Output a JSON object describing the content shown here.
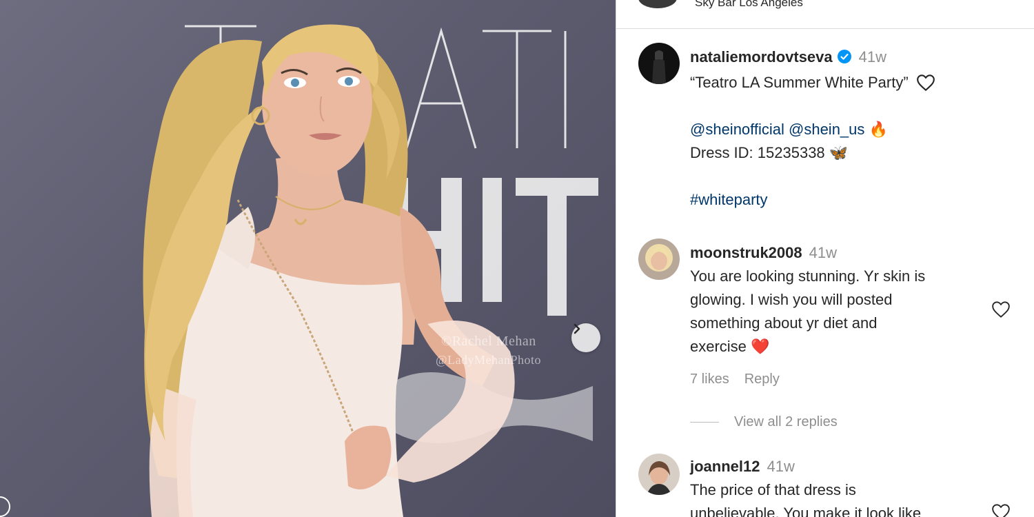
{
  "post": {
    "location": "Sky Bar Los Angeles",
    "author": "nataliemordovtseva",
    "timestamp": "41w",
    "caption_line1": "“Teatro LA Summer White Party”",
    "caption_mentions": "@sheinofficial @shein_us",
    "caption_dress": "Dress ID: 15235338",
    "caption_hashtag": "#whiteparty",
    "emoji_fire": "🔥",
    "emoji_butterfly": "🦋"
  },
  "photo": {
    "watermark_line1": "©Rachel Mehan",
    "watermark_line2": "@LadyMehanPhoto"
  },
  "comments": [
    {
      "username": "moonstruk2008",
      "timestamp": "41w",
      "line1": "You are looking stunning. Yr skin is",
      "line2": "glowing. I wish you will posted",
      "line3": "something about yr diet and",
      "line4": "exercise",
      "emoji": "❤️",
      "likes": "7 likes",
      "reply": "Reply",
      "view_replies": "View all 2 replies"
    },
    {
      "username": "joannel12",
      "timestamp": "41w",
      "line1": "The price of that dress is",
      "line2": "unbelievable. You make it look like"
    }
  ],
  "colors": {
    "text": "#262626",
    "secondary": "#8e8e8e",
    "link": "#00376b",
    "verified": "#0095f6",
    "divider": "#dbdbdb"
  },
  "icons": [
    "heart-icon",
    "verified-icon",
    "chevron-right-icon"
  ]
}
